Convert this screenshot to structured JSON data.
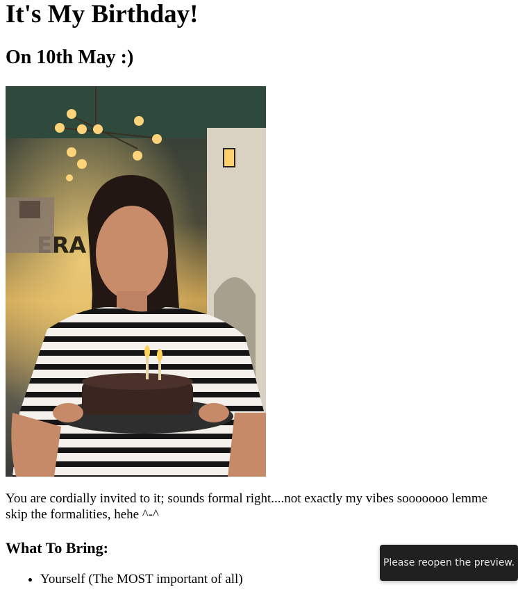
{
  "page": {
    "title": "It's My Birthday!",
    "subtitle": "On 10th May :)",
    "photo_description": "",
    "intro": "You are cordially invited to it; sounds formal right....not exactly my vibes sooooooo lemme skip the formalities, hehe ^-^",
    "bring_heading": "What To Bring:",
    "bring_items": [
      "Yourself (The MOST important of all)"
    ]
  },
  "toast": {
    "message": "Please reopen the preview."
  }
}
